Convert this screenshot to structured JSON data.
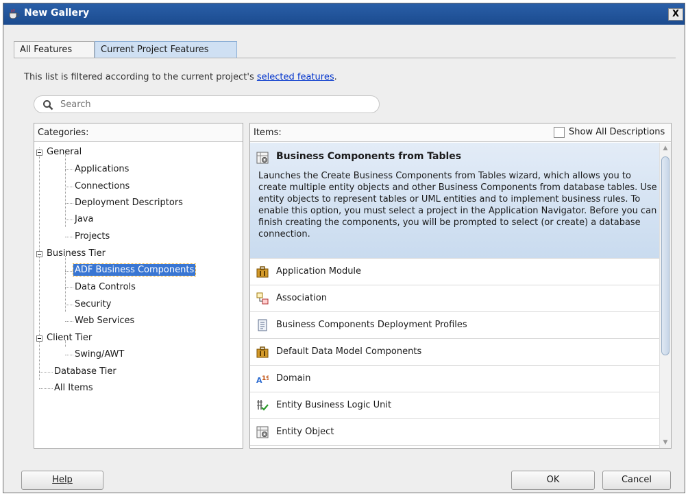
{
  "window": {
    "title": "New Gallery",
    "close_glyph": "X"
  },
  "tabs": [
    {
      "label": "All Features",
      "active": false
    },
    {
      "label": "Current Project Features",
      "active": true
    }
  ],
  "filter_notice": {
    "text": "This list is filtered according to the current project's ",
    "link": "selected features",
    "suffix": "."
  },
  "search": {
    "placeholder": "Search",
    "value": ""
  },
  "categories": {
    "header": "Categories:",
    "tree": [
      {
        "label": "General",
        "level": 0,
        "expanded": true
      },
      {
        "label": "Applications",
        "level": 1
      },
      {
        "label": "Connections",
        "level": 1
      },
      {
        "label": "Deployment Descriptors",
        "level": 1
      },
      {
        "label": "Java",
        "level": 1
      },
      {
        "label": "Projects",
        "level": 1
      },
      {
        "label": "Business Tier",
        "level": 0,
        "expanded": true
      },
      {
        "label": "ADF Business Components",
        "level": 1,
        "selected": true
      },
      {
        "label": "Data Controls",
        "level": 1
      },
      {
        "label": "Security",
        "level": 1
      },
      {
        "label": "Web Services",
        "level": 1
      },
      {
        "label": "Client Tier",
        "level": 0,
        "expanded": true
      },
      {
        "label": "Swing/AWT",
        "level": 1
      },
      {
        "label": "Database Tier",
        "level": 0
      },
      {
        "label": "All Items",
        "level": 0
      }
    ]
  },
  "items": {
    "header": "Items:",
    "show_all_label": "Show All Descriptions",
    "show_all_checked": false,
    "list": [
      {
        "name": "Business Components from Tables",
        "icon": "bc-tables-icon",
        "selected": true,
        "description": "Launches the Create Business Components from Tables wizard, which allows you to create multiple entity objects and other Business Components from database tables. Use entity objects to represent tables or UML entities and to implement business rules. To enable this option, you must select a project in the Application Navigator. Before you can finish creating the components, you will be prompted to select (or create) a database connection."
      },
      {
        "name": "Application Module",
        "icon": "application-module-icon"
      },
      {
        "name": "Association",
        "icon": "association-icon"
      },
      {
        "name": "Business Components Deployment Profiles",
        "icon": "deployment-profile-icon"
      },
      {
        "name": "Default Data Model Components",
        "icon": "data-model-icon"
      },
      {
        "name": "Domain",
        "icon": "domain-icon"
      },
      {
        "name": "Entity Business Logic Unit",
        "icon": "business-logic-unit-icon"
      },
      {
        "name": "Entity Object",
        "icon": "entity-object-icon"
      }
    ]
  },
  "buttons": {
    "help": "Help",
    "ok": "OK",
    "cancel": "Cancel"
  },
  "colors": {
    "title_bar": "#1f4f94",
    "selection": "#3976d3",
    "link": "#0033cc"
  }
}
